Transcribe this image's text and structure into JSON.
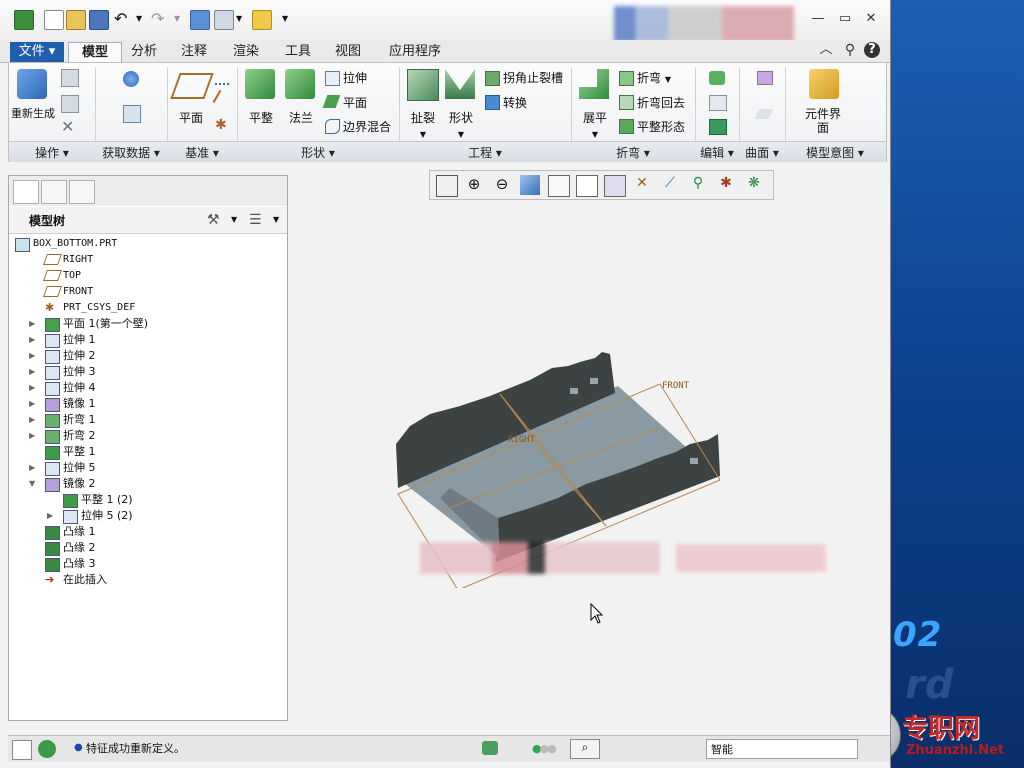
{
  "tabs": [
    "文件",
    "模型",
    "分析",
    "注释",
    "渲染",
    "工具",
    "视图",
    "应用程序"
  ],
  "ribbon": {
    "operations": {
      "regen": "重新生成",
      "group": "操作"
    },
    "get_data": {
      "group": "获取数据"
    },
    "datum": {
      "plane": "平面",
      "group": "基准"
    },
    "shapes": {
      "flat": "平整",
      "flange": "法兰",
      "extrude": "拉伸",
      "plane": "平面",
      "blend": "边界混合",
      "group": "形状"
    },
    "engineering": {
      "rip": "扯裂",
      "form": "形状",
      "corner_relief": "拐角止裂槽",
      "convert": "转换",
      "group": "工程"
    },
    "bend": {
      "unbend": "展平",
      "bend": "折弯",
      "bend_back": "折弯回去",
      "flat_pattern": "平整形态",
      "group": "折弯"
    },
    "edit": {
      "group": "编辑"
    },
    "surface": {
      "group": "曲面"
    },
    "model_intent": {
      "component_interface": "元件界面",
      "group": "模型意图"
    }
  },
  "model_tree": {
    "title": "模型树",
    "items": [
      {
        "label": "BOX_BOTTOM.PRT",
        "icon": "part-icon",
        "level": 0,
        "mono": true,
        "exp": ""
      },
      {
        "label": "RIGHT",
        "icon": "datum-plane-icon",
        "level": 1,
        "mono": true,
        "exp": ""
      },
      {
        "label": "TOP",
        "icon": "datum-plane-icon",
        "level": 1,
        "mono": true,
        "exp": ""
      },
      {
        "label": "FRONT",
        "icon": "datum-plane-icon",
        "level": 1,
        "mono": true,
        "exp": ""
      },
      {
        "label": "PRT_CSYS_DEF",
        "icon": "csys-icon",
        "level": 1,
        "mono": true,
        "exp": ""
      },
      {
        "label": "平面 1(第一个壁)",
        "icon": "flat-wall-icon",
        "level": 1,
        "exp": "▶"
      },
      {
        "label": "拉伸 1",
        "icon": "extrude-icon",
        "level": 1,
        "exp": "▶"
      },
      {
        "label": "拉伸 2",
        "icon": "extrude-icon",
        "level": 1,
        "exp": "▶"
      },
      {
        "label": "拉伸 3",
        "icon": "extrude-icon",
        "level": 1,
        "exp": "▶"
      },
      {
        "label": "拉伸 4",
        "icon": "extrude-icon",
        "level": 1,
        "exp": "▶"
      },
      {
        "label": "镜像 1",
        "icon": "mirror-icon",
        "level": 1,
        "exp": "▶"
      },
      {
        "label": "折弯 1",
        "icon": "bend-icon",
        "level": 1,
        "exp": "▶"
      },
      {
        "label": "折弯 2",
        "icon": "bend-icon",
        "level": 1,
        "exp": "▶"
      },
      {
        "label": "平整 1",
        "icon": "flat-icon",
        "level": 1,
        "exp": ""
      },
      {
        "label": "拉伸 5",
        "icon": "extrude-icon",
        "level": 1,
        "exp": "▶"
      },
      {
        "label": "镜像 2",
        "icon": "mirror-icon",
        "level": 1,
        "exp": "▼"
      },
      {
        "label": "平整 1 (2)",
        "icon": "flat-icon",
        "level": 2,
        "exp": ""
      },
      {
        "label": "拉伸 5 (2)",
        "icon": "extrude-icon",
        "level": 2,
        "exp": "▶"
      },
      {
        "label": "凸缘 1",
        "icon": "flange-icon",
        "level": 1,
        "exp": ""
      },
      {
        "label": "凸缘 2",
        "icon": "flange-icon",
        "level": 1,
        "exp": ""
      },
      {
        "label": "凸缘 3",
        "icon": "flange-icon",
        "level": 1,
        "exp": ""
      },
      {
        "label": "在此插入",
        "icon": "insert-here-icon",
        "level": 1,
        "exp": ""
      }
    ]
  },
  "viewport": {
    "labels": {
      "front": "FRONT",
      "right": "RIGHT"
    }
  },
  "status": {
    "message": "特征成功重新定义。",
    "filter": "智能"
  },
  "watermark": {
    "cn": "专职网",
    "en": "Zhuanzhi.Net",
    "num": "02",
    "faint": "rd"
  },
  "colors": {
    "accent": "#1a5fb4",
    "model": "#3d4342",
    "surface": "#8a9aa3",
    "datum": "#b8874a"
  }
}
